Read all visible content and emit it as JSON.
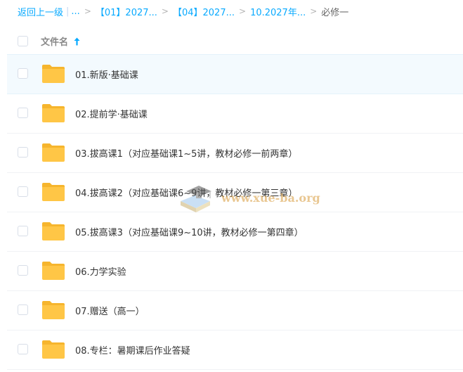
{
  "breadcrumb": {
    "back_label": "返回上一级",
    "pipe": "|",
    "ellipsis": "...",
    "separator": ">",
    "items": [
      "【01】2027...",
      "【04】2027...",
      "10.2027年..."
    ],
    "current": "必修一"
  },
  "header": {
    "column_label": "文件名",
    "sort_icon": "arrow-up-icon"
  },
  "files": [
    {
      "name": "01.新版·基础课",
      "icon": "folder-icon"
    },
    {
      "name": "02.提前学·基础课",
      "icon": "folder-icon"
    },
    {
      "name": "03.拔高课1（对应基础课1~5讲，教材必修一前两章）",
      "icon": "folder-icon"
    },
    {
      "name": "04.拔高课2（对应基础课6~9讲，教材必修一第三章）",
      "icon": "folder-icon"
    },
    {
      "name": "05.拔高课3（对应基础课9~10讲，教材必修一第四章）",
      "icon": "folder-icon"
    },
    {
      "name": "06.力学实验",
      "icon": "folder-icon"
    },
    {
      "name": "07.赠送（高一）",
      "icon": "folder-icon"
    },
    {
      "name": "08.专栏：暑期课后作业答疑",
      "icon": "folder-icon"
    }
  ],
  "watermark": {
    "text": "www.xue-ba.org"
  },
  "colors": {
    "link": "#09aaff",
    "folder": "#ffc646",
    "folder_dark": "#f6b52d",
    "highlight_row": "#f3fafe"
  }
}
